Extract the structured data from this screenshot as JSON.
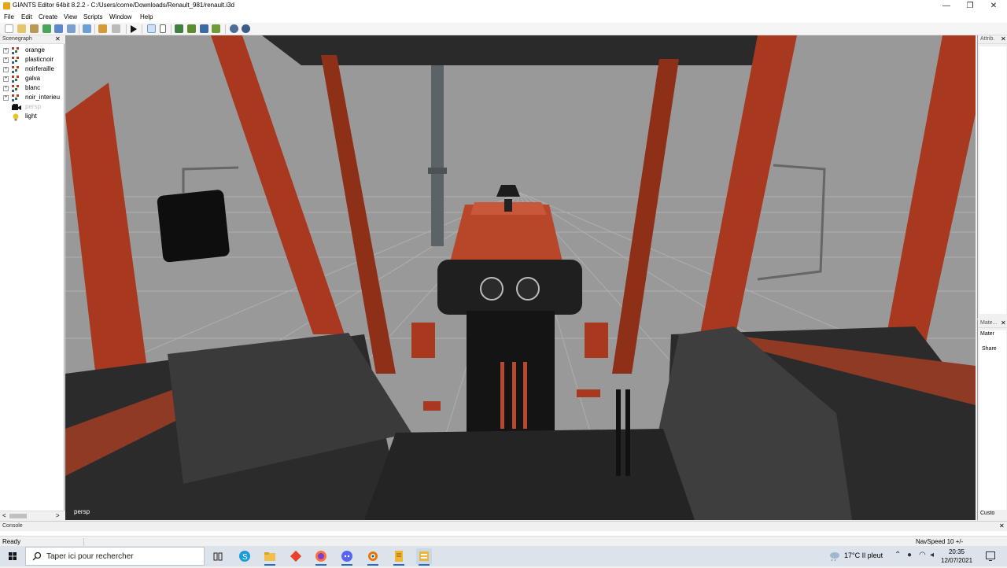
{
  "window": {
    "title": "GIANTS Editor 64bit 8.2.2 - C:/Users/corne/Downloads/Renault_981/renault.i3d",
    "minimize_glyph": "—",
    "maximize_glyph": "❐",
    "close_glyph": "✕"
  },
  "menu": [
    "File",
    "Edit",
    "Create",
    "View",
    "Scripts",
    "Window",
    "Help"
  ],
  "toolbar": {
    "icons": [
      "new-file-icon",
      "open-icon",
      "save-icon",
      "reload-icon",
      "save-as-icon",
      "export-icon",
      "refresh-icon",
      "undo-icon",
      "redo-icon",
      "play-icon",
      "select-icon",
      "move-icon",
      "terrain-icon",
      "paint-icon",
      "foliage-icon",
      "spline-icon",
      "settings-icon",
      "camera-icon"
    ]
  },
  "scenegraph": {
    "title": "Scenegraph",
    "close_glyph": "✕",
    "nodes": [
      {
        "label": "orange",
        "expander": "+",
        "icon": "transform-group-icon",
        "color": "#c0392b"
      },
      {
        "label": "plasticnoir",
        "expander": "+",
        "icon": "transform-group-icon",
        "color": "#c0392b"
      },
      {
        "label": "noirferaille",
        "expander": "+",
        "icon": "transform-group-icon",
        "color": "#c0392b"
      },
      {
        "label": "galva",
        "expander": "+",
        "icon": "transform-group-icon",
        "color": "#c0392b"
      },
      {
        "label": "blanc",
        "expander": "+",
        "icon": "transform-group-icon",
        "color": "#c0392b"
      },
      {
        "label": "noir_interieu",
        "expander": "+",
        "icon": "transform-group-icon",
        "color": "#c0392b"
      },
      {
        "label": "persp",
        "expander": "",
        "icon": "camera-icon",
        "color": "#bbbbbb"
      },
      {
        "label": "light",
        "expander": "",
        "icon": "light-bulb-icon",
        "color": "#e6c619"
      }
    ],
    "scroll_left": "<",
    "scroll_right": ">"
  },
  "viewport": {
    "camera_label": "persp",
    "background": "#9a9a9a",
    "cab_color": "#a8391f"
  },
  "attributes": {
    "title": "Attrib.",
    "close_glyph": "✕"
  },
  "material": {
    "title": "Mate...",
    "close_glyph": "✕",
    "tab": "Mater",
    "share_label": "Share",
    "footer": "Custo"
  },
  "console": {
    "title": "Console",
    "close_glyph": "✕"
  },
  "status": {
    "ready": "Ready",
    "navspeed": "NavSpeed 10 +/-"
  },
  "taskbar": {
    "search_placeholder": "Taper ici pour rechercher",
    "apps": [
      "task-view-icon",
      "skype-icon",
      "file-explorer-icon",
      "git-icon",
      "firefox-icon",
      "discord-icon",
      "blender-icon",
      "notepad-icon",
      "giants-editor-icon"
    ],
    "weather": "17°C  Il pleut",
    "time": "20:35",
    "date": "12/07/2021"
  }
}
